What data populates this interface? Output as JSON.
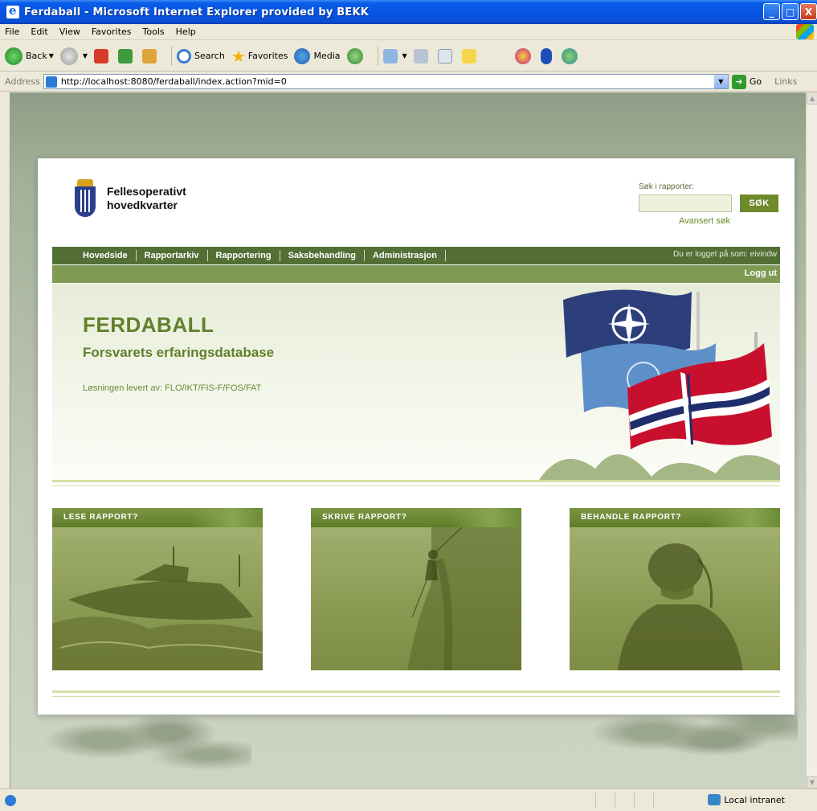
{
  "window": {
    "title": "Ferdaball - Microsoft Internet Explorer provided by BEKK",
    "buttons": {
      "minimize": "_",
      "maximize": "□",
      "close": "X"
    }
  },
  "menu": [
    "File",
    "Edit",
    "View",
    "Favorites",
    "Tools",
    "Help"
  ],
  "toolbar": {
    "back": "Back",
    "search": "Search",
    "favorites": "Favorites",
    "media": "Media"
  },
  "address": {
    "label": "Address",
    "url": "http://localhost:8080/ferdaball/index.action?mid=0",
    "go": "Go",
    "links": "Links"
  },
  "site": {
    "brand_line1": "Fellesoperativt",
    "brand_line2": "hovedkvarter",
    "search_label": "Søk i rapporter:",
    "search_button": "SØK",
    "advanced_search": "Avansert søk",
    "nav": [
      "Hovedside",
      "Rapportarkiv",
      "Rapportering",
      "Saksbehandling",
      "Administrasjon"
    ],
    "logged_in": "Du er logget på som: eivindw",
    "logout": "Logg ut",
    "hero_title": "FERDABALL",
    "hero_subtitle": "Forsvarets erfaringsdatabase",
    "hero_credit": "Løsningen levert av: FLO/IKT/FIS-F/FOS/FAT",
    "panels": [
      {
        "title": "LESE RAPPORT?"
      },
      {
        "title": "SKRIVE RAPPORT?"
      },
      {
        "title": "BEHANDLE RAPPORT?"
      }
    ]
  },
  "status": {
    "zone": "Local intranet"
  },
  "colors": {
    "nav_green": "#536f35",
    "sub_green": "#7f9a53",
    "hero_text": "#61802b",
    "xp_blue": "#0554e3"
  }
}
